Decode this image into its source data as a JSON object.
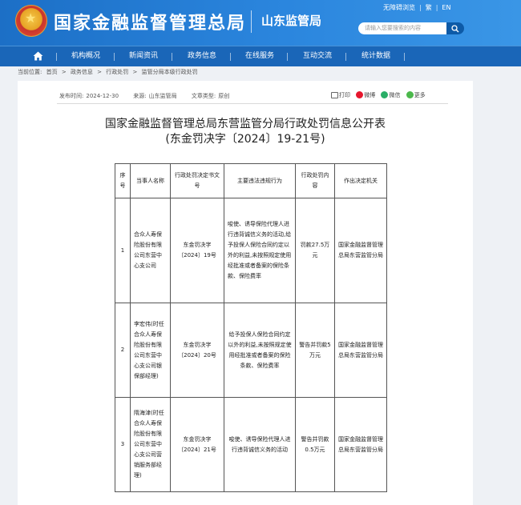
{
  "header": {
    "site_title": "国家金融监督管理总局",
    "sub_title": "山东监管局",
    "links": [
      "无障碍浏览",
      "繁",
      "EN"
    ],
    "search_placeholder": "请输入您要搜索的内容",
    "colors": {
      "header_bg": "#2b86de",
      "nav_bg": "#1a66b8"
    }
  },
  "nav": {
    "home_icon": "home-icon",
    "items": [
      "机构概况",
      "新闻资讯",
      "政务信息",
      "在线服务",
      "互动交流",
      "统计数据"
    ]
  },
  "breadcrumb": {
    "label": "当前位置:",
    "items": [
      "首页",
      ">",
      "政务信息",
      ">",
      "行政处罚",
      ">",
      "监管分局本级行政处罚"
    ]
  },
  "article": {
    "meta": {
      "time_label": "发布时间:",
      "time": "2024-12-30",
      "source_label": "来源:",
      "source": "山东监管局",
      "type_label": "文章类型:",
      "type": "原创"
    },
    "share": [
      "打印",
      "微博",
      "微信",
      "更多"
    ],
    "title_line1": "国家金融监督管理总局东营监管分局行政处罚信息公开表",
    "title_line2": "(东金罚决字〔2024〕19-21号)"
  },
  "table": {
    "headers": [
      "序号",
      "当事人名称",
      "行政处罚决定书文号",
      "主要违法违规行为",
      "行政处罚内容",
      "作出决定机关"
    ],
    "rows": [
      {
        "no": "1",
        "party": "合众人寿保险股份有限公司东营中心支公司",
        "doc_no": "东金罚决字〔2024〕19号",
        "violation": "唆使、诱导保险代理人进行违背诚信义务的活动,给予投保人保险合同约定以外的利益,未按照规定使用经批准或者备案的保险条款、保险费率",
        "penalty": "罚款27.5万元",
        "authority": "国家金融监督管理总局东营监管分局"
      },
      {
        "no": "2",
        "party": "李宏伟(时任合众人寿保险股份有限公司东营中心支公司银保部经理)",
        "doc_no": "东金罚决字〔2024〕20号",
        "violation": "给予投保人保险合同约定以外的利益,未按照规定使用经批准或者备案的保险条款、保险费率",
        "penalty": "警告并罚款5万元",
        "authority": "国家金融监督管理总局东营监管分局"
      },
      {
        "no": "3",
        "party": "隋海津(时任合众人寿保险股份有限公司东营中心支公司营销服务部经理)",
        "doc_no": "东金罚决字〔2024〕21号",
        "violation": "唆使、诱导保险代理人进行违背诚信义务的活动",
        "penalty": "警告并罚款0.5万元",
        "authority": "国家金融监督管理总局东营监管分局"
      }
    ]
  }
}
